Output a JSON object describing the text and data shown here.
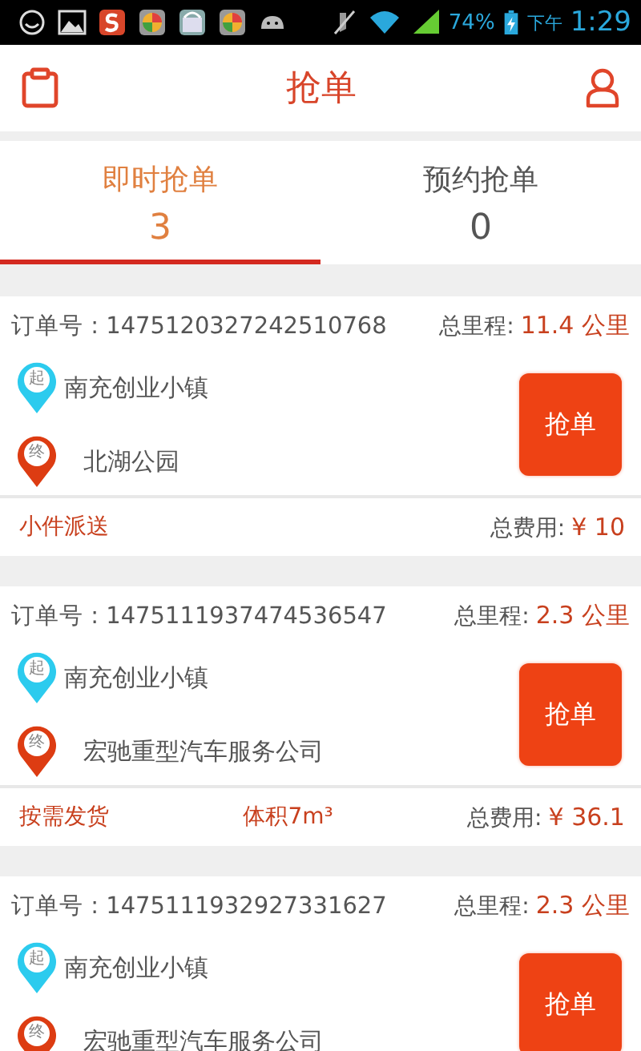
{
  "status_bar": {
    "battery": "74%",
    "period": "下午",
    "time": "1:29"
  },
  "header": {
    "title": "抢单"
  },
  "tabs": [
    {
      "label": "即时抢单",
      "count": "3",
      "selected": true
    },
    {
      "label": "预约抢单",
      "count": "0",
      "selected": false
    }
  ],
  "orders": [
    {
      "order_no": "订单号 : 1475120327242510768",
      "distance_label": "总里程:",
      "distance": "11.4 公里",
      "start": {
        "pin": "起",
        "place": "南充创业小镇"
      },
      "end": {
        "pin": "终",
        "place": "北湖公园"
      },
      "button": "抢单",
      "footer": {
        "tag": "小件派送",
        "fee_label": "总费用:",
        "fee": "¥ 10"
      }
    },
    {
      "order_no": "订单号 : 1475111937474536547",
      "distance_label": "总里程:",
      "distance": "2.3 公里",
      "start": {
        "pin": "起",
        "place": "南充创业小镇"
      },
      "end": {
        "pin": "终",
        "place": "宏驰重型汽车服务公司"
      },
      "button": "抢单",
      "footer": {
        "tag": "按需发货",
        "volume": "体积7m³",
        "fee_label": "总费用:",
        "fee": "¥ 36.1"
      }
    },
    {
      "order_no": "订单号 : 1475111932927331627",
      "distance_label": "总里程:",
      "distance": "2.3 公里",
      "start": {
        "pin": "起",
        "place": "南充创业小镇"
      },
      "end": {
        "pin": "终",
        "place": "宏驰重型汽车服务公司"
      },
      "button": "抢单"
    }
  ]
}
